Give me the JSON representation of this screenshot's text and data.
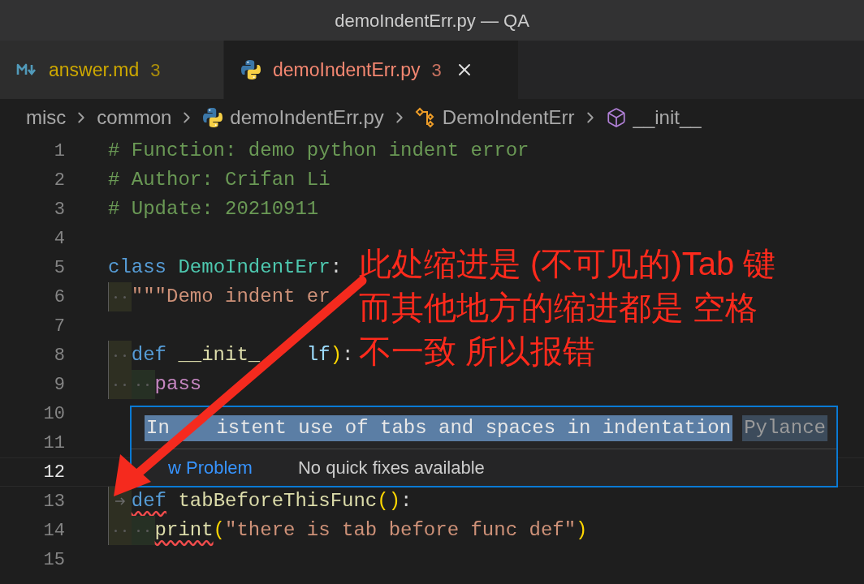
{
  "window": {
    "title": "demoIndentErr.py — QA"
  },
  "tabs": [
    {
      "label": "answer.md",
      "problems": "3",
      "color": "#cca700",
      "kind": "markdown",
      "selected": false
    },
    {
      "label": "demoIndentErr.py",
      "problems": "3",
      "color": "#f48771",
      "kind": "python",
      "selected": true
    }
  ],
  "breadcrumb": [
    {
      "label": "misc",
      "kind": "folder"
    },
    {
      "label": "common",
      "kind": "folder"
    },
    {
      "label": "demoIndentErr.py",
      "kind": "python"
    },
    {
      "label": "DemoIndentErr",
      "kind": "class"
    },
    {
      "label": "__init__",
      "kind": "method"
    }
  ],
  "editor": {
    "lines": [
      {
        "number": "1",
        "current": false,
        "tokens": [
          {
            "text": "# Function: demo python indent error",
            "kind": "comment"
          }
        ]
      },
      {
        "number": "2",
        "current": false,
        "tokens": [
          {
            "text": "# Author: Crifan Li",
            "kind": "comment"
          }
        ]
      },
      {
        "number": "3",
        "current": false,
        "tokens": [
          {
            "text": "# Update: 20210911",
            "kind": "comment"
          }
        ]
      },
      {
        "number": "4",
        "current": false
      },
      {
        "number": "5",
        "current": false,
        "tokens": [
          {
            "text": "class ",
            "kind": "keyword"
          },
          {
            "text": "DemoIndentErr",
            "kind": "class-name"
          },
          {
            "text": ":",
            "kind": "punct"
          }
        ]
      },
      {
        "number": "6",
        "current": false,
        "indent": [
          {
            "kind": "space"
          }
        ],
        "tokens": [
          {
            "text": "\"\"\"Demo indent er",
            "kind": "string"
          }
        ]
      },
      {
        "number": "7",
        "current": false
      },
      {
        "number": "8",
        "current": false,
        "indent": [
          {
            "kind": "space"
          }
        ],
        "tokens": [
          {
            "text": "def ",
            "kind": "keyword"
          },
          {
            "text": "__init_",
            "kind": "func"
          },
          {
            "text": "    lf",
            "kind": "param"
          },
          {
            "text": ")",
            "kind": "paren"
          },
          {
            "text": ":",
            "kind": "punct"
          }
        ]
      },
      {
        "number": "9",
        "current": false,
        "indent": [
          {
            "kind": "space"
          },
          {
            "kind": "space"
          }
        ],
        "tokens": [
          {
            "text": "pass",
            "kind": "control"
          }
        ]
      },
      {
        "number": "10",
        "current": false
      },
      {
        "number": "11",
        "current": false
      },
      {
        "number": "12",
        "current": true
      },
      {
        "number": "13",
        "current": false,
        "indent": [
          {
            "kind": "tab"
          }
        ],
        "tokens": [
          {
            "text": "def",
            "kind": "keyword",
            "error": true
          },
          {
            "text": " tabBeforeThisFunc",
            "kind": "func",
            "error": false
          },
          {
            "text": "()",
            "kind": "paren"
          },
          {
            "text": ":",
            "kind": "punct"
          }
        ]
      },
      {
        "number": "14",
        "current": false,
        "indent": [
          {
            "kind": "space"
          },
          {
            "kind": "space"
          }
        ],
        "tokens": [
          {
            "text": "print",
            "kind": "func",
            "error": true
          },
          {
            "text": "(",
            "kind": "paren"
          },
          {
            "text": "\"there is tab before func def\"",
            "kind": "string"
          },
          {
            "text": ")",
            "kind": "paren"
          }
        ]
      },
      {
        "number": "15",
        "current": false
      }
    ]
  },
  "hover": {
    "message": "In    istent use of tabs and spaces in indentation",
    "source": "Pylance",
    "actions": [
      {
        "label": "w Problem",
        "kind": "link"
      },
      {
        "label": "No quick fixes available",
        "kind": "note"
      }
    ]
  },
  "annotation": {
    "lines": [
      "此处缩进是 (不可见的)Tab 键",
      "而其他地方的缩进都是 空格",
      "不一致 所以报错"
    ]
  }
}
